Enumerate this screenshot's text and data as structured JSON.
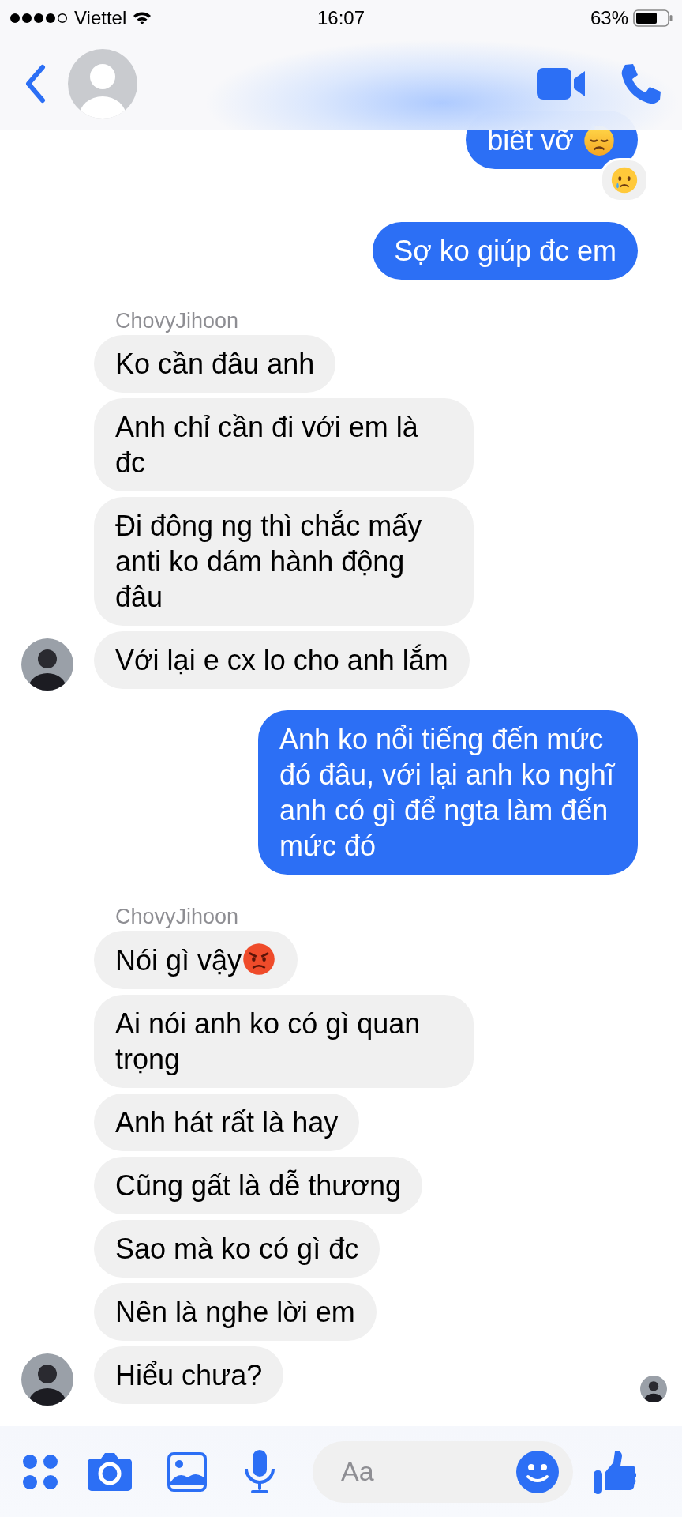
{
  "status_bar": {
    "carrier": "Viettel",
    "time": "16:07",
    "battery": "63%"
  },
  "groups": [
    {
      "kind": "outgoing",
      "messages": [
        {
          "text": "biết vỡ",
          "emoji": {
            "kind": "sweat"
          },
          "reaction": {
            "kind": "cry"
          }
        },
        {
          "text": "Sợ ko giúp đc em"
        }
      ]
    },
    {
      "kind": "incoming",
      "sender": "ChovyJihoon",
      "messages": [
        {
          "text": "Ko cần đâu anh"
        },
        {
          "text": "Anh chỉ cần đi với em là đc"
        },
        {
          "text": "Đi đông ng thì chắc mấy anti ko dám hành động đâu"
        },
        {
          "text": "Với lại e cx lo cho anh lắm"
        }
      ]
    },
    {
      "kind": "outgoing",
      "messages": [
        {
          "text": "Anh ko nổi tiếng đến mức đó đâu, với lại anh ko nghĩ anh có gì để ngta làm đến mức đó"
        }
      ]
    },
    {
      "kind": "incoming",
      "sender": "ChovyJihoon",
      "seen": true,
      "messages": [
        {
          "text": "Nói gì vậy",
          "emoji": {
            "kind": "angry"
          }
        },
        {
          "text": "Ai nói anh ko có gì quan trọng"
        },
        {
          "text": "Anh hát rất là hay"
        },
        {
          "text": "Cũng gất là dễ thương"
        },
        {
          "text": "Sao mà ko có gì đc"
        },
        {
          "text": "Nên là nghe lời em"
        },
        {
          "text": "Hiểu chưa?"
        }
      ]
    }
  ],
  "composer": {
    "placeholder": "Aa"
  }
}
